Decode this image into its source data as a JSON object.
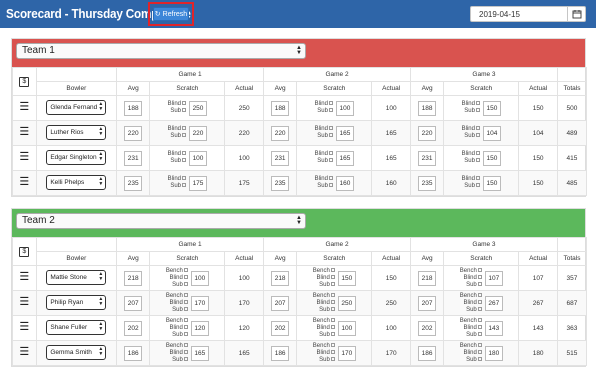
{
  "header": {
    "title": "Scorecard - Thursday Competitive",
    "refresh_label": "Refresh",
    "date_value": "2019-04-15"
  },
  "colors": {
    "topbar": "#2e65a8",
    "team1_band": "#d9534f",
    "team2_band": "#5cb85c",
    "refresh": "#3d86d8",
    "highlight": "#e0242a"
  },
  "table_headers": {
    "bowler": "Bowler",
    "games": [
      "Game 1",
      "Game 2",
      "Game 3"
    ],
    "avg": "Avg",
    "scratch": "Scratch",
    "actual": "Actual",
    "totals": "Totals"
  },
  "labels": {
    "blind": "Blind",
    "sub": "Sub",
    "bench": "Bench"
  },
  "teams": [
    {
      "name": "Team 1",
      "band_color": "#d9534f",
      "bowlers": [
        {
          "name": "Glenda Fernand",
          "total": "500",
          "games": [
            {
              "avg": "188",
              "scratch": "250",
              "actual": "250"
            },
            {
              "avg": "188",
              "scratch": "100",
              "actual": "100"
            },
            {
              "avg": "188",
              "scratch": "150",
              "actual": "150"
            }
          ]
        },
        {
          "name": "Luther Rios",
          "total": "489",
          "games": [
            {
              "avg": "220",
              "scratch": "220",
              "actual": "220"
            },
            {
              "avg": "220",
              "scratch": "165",
              "actual": "165"
            },
            {
              "avg": "220",
              "scratch": "104",
              "actual": "104"
            }
          ]
        },
        {
          "name": "Edgar Singleton",
          "total": "415",
          "games": [
            {
              "avg": "231",
              "scratch": "100",
              "actual": "100"
            },
            {
              "avg": "231",
              "scratch": "165",
              "actual": "165"
            },
            {
              "avg": "231",
              "scratch": "150",
              "actual": "150"
            }
          ]
        },
        {
          "name": "Kelli Phelps",
          "total": "485",
          "games": [
            {
              "avg": "235",
              "scratch": "175",
              "actual": "175"
            },
            {
              "avg": "235",
              "scratch": "160",
              "actual": "160"
            },
            {
              "avg": "235",
              "scratch": "150",
              "actual": "150"
            }
          ]
        }
      ]
    },
    {
      "name": "Team 2",
      "band_color": "#5cb85c",
      "bowlers": [
        {
          "name": "Mattie Stone",
          "total": "357",
          "games": [
            {
              "avg": "218",
              "scratch": "100",
              "actual": "100"
            },
            {
              "avg": "218",
              "scratch": "150",
              "actual": "150"
            },
            {
              "avg": "218",
              "scratch": "107",
              "actual": "107"
            }
          ]
        },
        {
          "name": "Philip Ryan",
          "total": "687",
          "games": [
            {
              "avg": "207",
              "scratch": "170",
              "actual": "170"
            },
            {
              "avg": "207",
              "scratch": "250",
              "actual": "250"
            },
            {
              "avg": "207",
              "scratch": "267",
              "actual": "267"
            }
          ]
        },
        {
          "name": "Shane Fuller",
          "total": "363",
          "games": [
            {
              "avg": "202",
              "scratch": "120",
              "actual": "120"
            },
            {
              "avg": "202",
              "scratch": "100",
              "actual": "100"
            },
            {
              "avg": "202",
              "scratch": "143",
              "actual": "143"
            }
          ]
        },
        {
          "name": "Gemma Smith",
          "total": "515",
          "games": [
            {
              "avg": "186",
              "scratch": "165",
              "actual": "165"
            },
            {
              "avg": "186",
              "scratch": "170",
              "actual": "170"
            },
            {
              "avg": "186",
              "scratch": "180",
              "actual": "180"
            }
          ]
        }
      ]
    }
  ]
}
